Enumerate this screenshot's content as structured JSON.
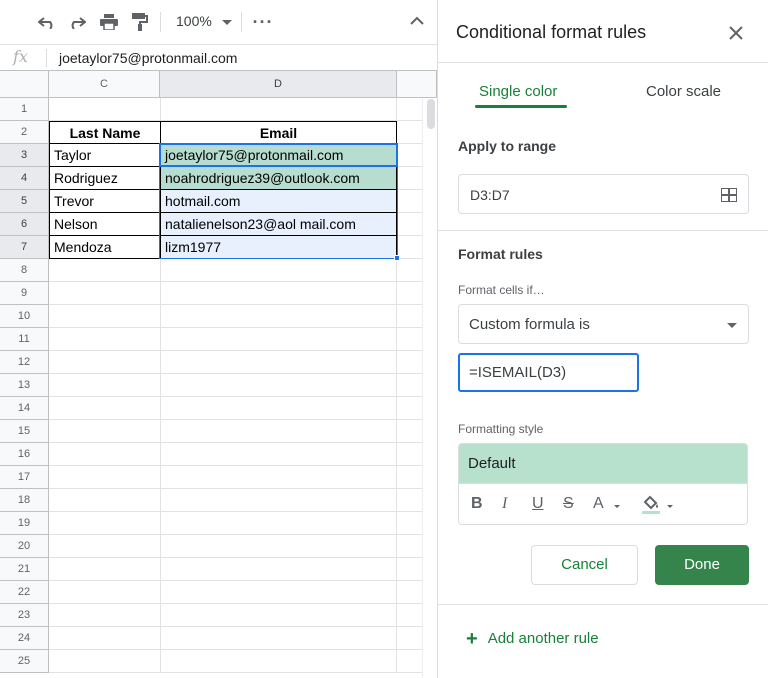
{
  "toolbar": {
    "zoom": "100%",
    "icons": [
      "undo-icon",
      "redo-icon",
      "print-icon",
      "paint-format-icon",
      "more-icon",
      "collapse-icon"
    ]
  },
  "formula_bar": {
    "fx": "fx",
    "value": "joetaylor75@protonmail.com"
  },
  "grid": {
    "columns": [
      "C",
      "D"
    ],
    "rows": [
      "1",
      "2",
      "3",
      "4",
      "5",
      "6",
      "7",
      "8",
      "9",
      "10",
      "11",
      "12",
      "13",
      "14",
      "15",
      "16",
      "17",
      "18",
      "19",
      "20",
      "21",
      "22",
      "23",
      "24",
      "25"
    ],
    "headers": {
      "c": "Last Name",
      "d": "Email"
    },
    "data": [
      {
        "c": "Taylor",
        "d": "joetaylor75@protonmail.com"
      },
      {
        "c": "Rodriguez",
        "d": "noahrodriguez39@outlook.com"
      },
      {
        "c": "Trevor",
        "d": "hotmail.com"
      },
      {
        "c": "Nelson",
        "d": "natalienelson23@aol mail.com"
      },
      {
        "c": "Mendoza",
        "d": "lizm1977"
      }
    ],
    "highlight_color": "#b7dcd0"
  },
  "panel": {
    "title": "Conditional format rules",
    "close_icon": "close-icon",
    "tabs": {
      "single": "Single color",
      "scale": "Color scale"
    },
    "apply_label": "Apply to range",
    "range": "D3:D7",
    "format_rules_label": "Format rules",
    "format_cells_if": "Format cells if…",
    "condition": "Custom formula is",
    "formula": "=ISEMAIL(D3)",
    "formatting_style_label": "Formatting style",
    "style_preview": "Default",
    "style_color": "#b7e1cd",
    "tools": {
      "bold": "B",
      "italic": "I",
      "underline": "U",
      "strike": "S",
      "text_color": "A"
    },
    "cancel": "Cancel",
    "done": "Done",
    "add_rule": "Add another rule",
    "accent": "#188038"
  }
}
